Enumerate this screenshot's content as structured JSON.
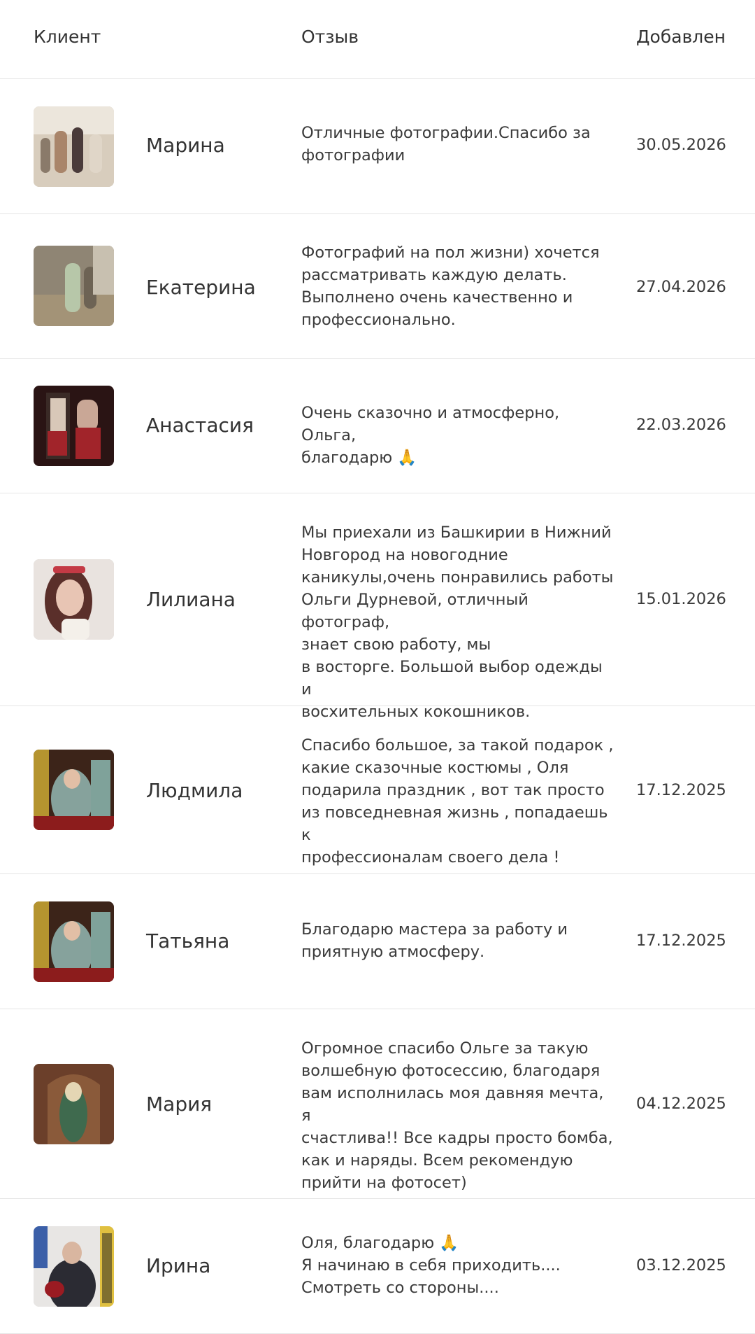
{
  "table": {
    "headers": {
      "client": "Клиент",
      "review": "Отзыв",
      "added": "Добавлен"
    },
    "rows": [
      {
        "name": "Марина",
        "review": "Отличные фотографии.Спасибо за\nфотографии",
        "date": "30.05.2026",
        "photo_colors": [
          "#d8cdbd",
          "#a9856a",
          "#4a3b3a"
        ]
      },
      {
        "name": "Екатерина",
        "review": "Фотографий на пол жизни) хочется\nрассматривать каждую делать.\nВыполнено очень качественно и\nпрофессионально.",
        "date": "27.04.2026",
        "photo_colors": [
          "#8f8574",
          "#b7c7a9",
          "#6d6354"
        ]
      },
      {
        "name": "Анастасия",
        "review": "Очень сказочно и атмосферно, Ольга,\nблагодарю 🙏",
        "date": "22.03.2026",
        "photo_colors": [
          "#2a1414",
          "#a1242a",
          "#d8c8b8"
        ]
      },
      {
        "name": "Лилиана",
        "review": "Мы приехали из Башкирии в Нижний\nНовгород на новогодние\nканикулы,очень понравились работы\nОльги Дурневой, отличный фотограф,\nзнает свою работу, мы\nв восторге. Большой выбор одежды и\nвосхительных кокошников.",
        "date": "15.01.2026",
        "photo_colors": [
          "#e9e3df",
          "#5a2f2a",
          "#c43a45"
        ]
      },
      {
        "name": "Людмила",
        "review": "Спасибо большое, за такой подарок ,\nкакие сказочные костюмы , Оля\nподарила праздник , вот так просто\nиз повседневная жизнь , попадаешь к\nпрофессионалам своего дела !",
        "date": "17.12.2025",
        "photo_colors": [
          "#3c2419",
          "#86a29c",
          "#b5942f"
        ]
      },
      {
        "name": "Татьяна",
        "review": "Благодарю мастера за работу и\nприятную атмосферу.",
        "date": "17.12.2025",
        "photo_colors": [
          "#3c2419",
          "#86a29c",
          "#b5942f"
        ]
      },
      {
        "name": "Мария",
        "review": "Огромное спасибо Ольге за такую\nволшебную фотосессию, благодаря\nвам исполнилась моя давняя мечта, я\nсчастлива!! Все кадры просто бомба,\nкак и наряды. Всем рекомендую\nприйти на фотосет)",
        "date": "04.12.2025",
        "photo_colors": [
          "#6b3f2a",
          "#3f6a4e",
          "#e4d6b4"
        ]
      },
      {
        "name": "Ирина",
        "review": "Оля, благодарю 🙏\nЯ начинаю в себя приходить....\nСмотреть со стороны....",
        "date": "03.12.2025",
        "photo_colors": [
          "#e8e6e4",
          "#2b2b33",
          "#9a1b22"
        ]
      }
    ]
  }
}
